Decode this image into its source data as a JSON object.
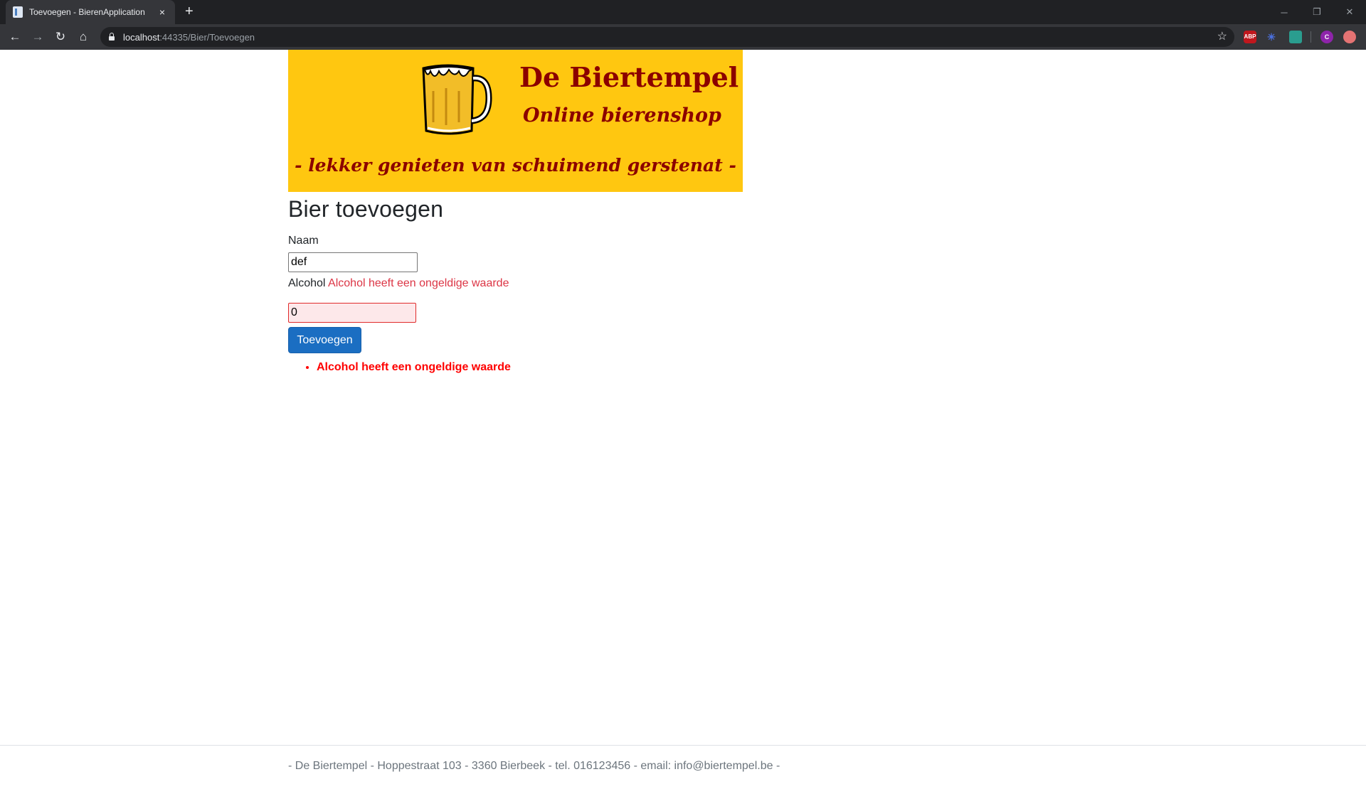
{
  "browser": {
    "tab_title": "Toevoegen - BierenApplication",
    "close_tab": "×",
    "new_tab": "+",
    "url_host": "localhost",
    "url_rest": ":44335/Bier/Toevoegen",
    "window_controls": {
      "minimize": "─",
      "restore": "❐",
      "close": "✕"
    },
    "extensions": {
      "abp": "ABP",
      "avatar": "C"
    }
  },
  "banner": {
    "title": "De Biertempel",
    "subtitle": "Online bierenshop",
    "tagline": "- lekker genieten van schuimend gerstenat -",
    "colors": {
      "background": "#ffc710",
      "text": "#8b0000"
    }
  },
  "form": {
    "heading": "Bier toevoegen",
    "naam_label": "Naam",
    "naam_value": "def",
    "alcohol_label": "Alcohol",
    "alcohol_error": "Alcohol heeft een ongeldige waarde",
    "alcohol_value": "0",
    "submit_label": "Toevoegen",
    "validation_summary": [
      "Alcohol heeft een ongeldige waarde"
    ]
  },
  "footer": {
    "text": "- De Biertempel - Hoppestraat 103 - 3360 Bierbeek - tel. 016123456 - email: info@biertempel.be -"
  }
}
